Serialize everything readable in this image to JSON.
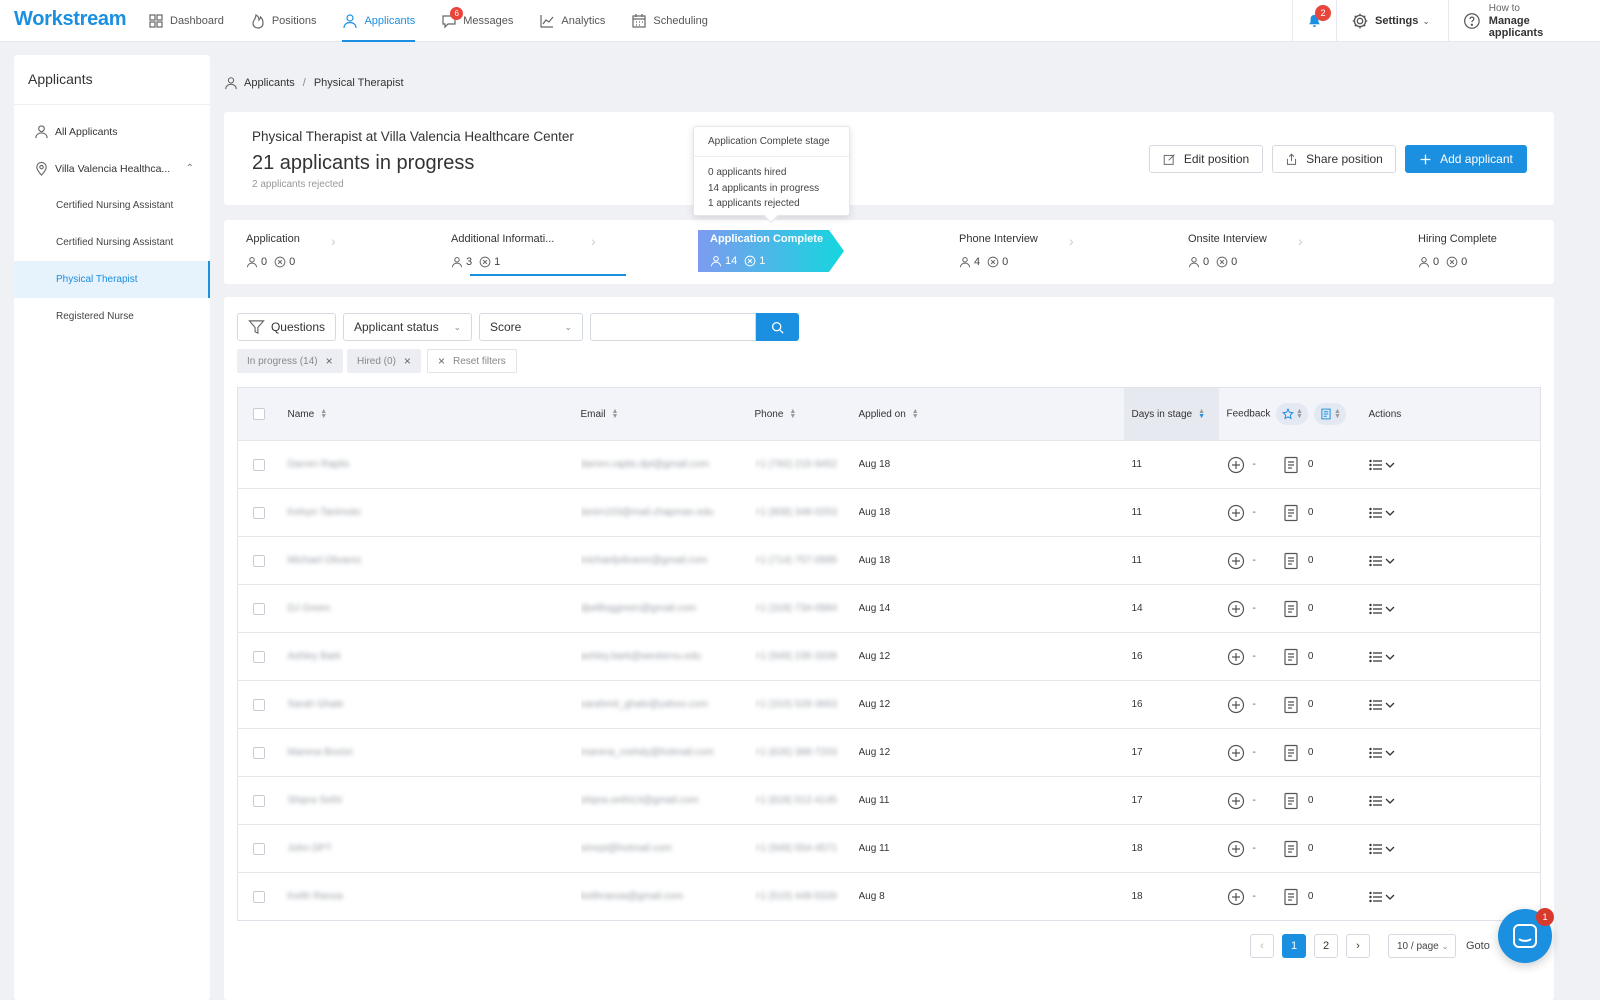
{
  "app": {
    "brand": "Workstream",
    "accent": "#1b8fe0"
  },
  "nav": [
    {
      "label": "Dashboard",
      "icon": "dashboard-icon",
      "active": false
    },
    {
      "label": "Positions",
      "icon": "flame-icon",
      "active": false
    },
    {
      "label": "Applicants",
      "icon": "person-icon",
      "active": true
    },
    {
      "label": "Messages",
      "icon": "chat-icon",
      "active": false,
      "badge": "6"
    },
    {
      "label": "Analytics",
      "icon": "line-chart-icon",
      "active": false
    },
    {
      "label": "Scheduling",
      "icon": "calendar-icon",
      "active": false
    }
  ],
  "topright": {
    "bell_badge": "2",
    "settings_label": "Settings",
    "howto_line1": "How to",
    "howto_line2": "Manage applicants"
  },
  "sidebar": {
    "title": "Applicants",
    "all_label": "All Applicants",
    "location_label": "Villa Valencia Healthca...",
    "positions": [
      {
        "label": "Certified Nursing Assistant",
        "active": false
      },
      {
        "label": "Certified Nursing Assistant",
        "active": false
      },
      {
        "label": "Physical Therapist",
        "active": true
      },
      {
        "label": "Registered Nurse",
        "active": false
      }
    ]
  },
  "breadcrumb": {
    "root": "Applicants",
    "sep": "/",
    "current": "Physical Therapist"
  },
  "position": {
    "subtitle": "Physical Therapist at Villa Valencia Healthcare Center",
    "title": "21 applicants in progress",
    "rejected": "2 applicants rejected",
    "edit_label": "Edit position",
    "share_label": "Share position",
    "add_label": "Add applicant"
  },
  "tooltip": {
    "title": "Application Complete stage",
    "hired": "0 applicants hired",
    "in_progress": "14 applicants in progress",
    "rejected": "1 applicants rejected"
  },
  "stages": [
    {
      "name": "Application",
      "people": "0",
      "rejected": "0"
    },
    {
      "name": "Additional Informati...",
      "people": "3",
      "rejected": "1"
    },
    {
      "name": "Application Complete",
      "people": "14",
      "rejected": "1",
      "active": true
    },
    {
      "name": "Phone Interview",
      "people": "4",
      "rejected": "0"
    },
    {
      "name": "Onsite Interview",
      "people": "0",
      "rejected": "0"
    },
    {
      "name": "Hiring Complete",
      "people": "0",
      "rejected": "0"
    }
  ],
  "filters": {
    "questions_label": "Questions",
    "status_label": "Applicant status",
    "score_label": "Score",
    "search_value": "",
    "chips": [
      "In progress (14)",
      "Hired (0)"
    ],
    "reset_label": "Reset filters"
  },
  "table": {
    "columns": {
      "name": "Name",
      "email": "Email",
      "phone": "Phone",
      "applied": "Applied on",
      "days": "Days in stage",
      "feedback": "Feedback",
      "actions": "Actions"
    },
    "rows": [
      {
        "name": "Darren Raptis",
        "email": "darren.raptis.dpt@gmail.com",
        "phone": "+1 (760) 215-9452",
        "applied": "Aug 18",
        "days": "11",
        "score": "-",
        "notes": "0"
      },
      {
        "name": "Kelsyn Tanimoto",
        "email": "tanim103@mail.chapman.edu",
        "phone": "+1 (808) 348-0253",
        "applied": "Aug 18",
        "days": "11",
        "score": "-",
        "notes": "0"
      },
      {
        "name": "Michael Olivarez",
        "email": "michaeljolivarez@gmail.com",
        "phone": "+1 (714) 757-0995",
        "applied": "Aug 18",
        "days": "11",
        "score": "-",
        "notes": "0"
      },
      {
        "name": "DJ Green",
        "email": "djwillisggreen@gmail.com",
        "phone": "+1 (318) 734-0984",
        "applied": "Aug 14",
        "days": "14",
        "score": "-",
        "notes": "0"
      },
      {
        "name": "Ashley Bark",
        "email": "ashley.bark@westernu.edu",
        "phone": "+1 (949) 235-3339",
        "applied": "Aug 12",
        "days": "16",
        "score": "-",
        "notes": "0"
      },
      {
        "name": "Sarah Ghale",
        "email": "sarahmit_ghale@yahoo.com",
        "phone": "+1 (310) 529-3663",
        "applied": "Aug 12",
        "days": "16",
        "score": "-",
        "notes": "0"
      },
      {
        "name": "Marena Boctor",
        "email": "marena_roshdy@hotmail.com",
        "phone": "+1 (626) 388-7203",
        "applied": "Aug 12",
        "days": "17",
        "score": "-",
        "notes": "0"
      },
      {
        "name": "Shipra Sethi",
        "email": "shipra.sethi14@gmail.com",
        "phone": "+1 (818) 512-4145",
        "applied": "Aug 11",
        "days": "17",
        "score": "-",
        "notes": "0"
      },
      {
        "name": "John DPT",
        "email": "simrpt@hotmail.com",
        "phone": "+1 (949) 554-4571",
        "applied": "Aug 11",
        "days": "18",
        "score": "-",
        "notes": "0"
      },
      {
        "name": "Keith Ranoa",
        "email": "keithranoa@gmail.com",
        "phone": "+1 (510) 449-5326",
        "applied": "Aug 8",
        "days": "18",
        "score": "-",
        "notes": "0"
      }
    ]
  },
  "pagination": {
    "pages": [
      "1",
      "2"
    ],
    "current": "1",
    "page_size": "10 / page",
    "goto_label": "Goto"
  },
  "chat": {
    "badge": "1"
  }
}
